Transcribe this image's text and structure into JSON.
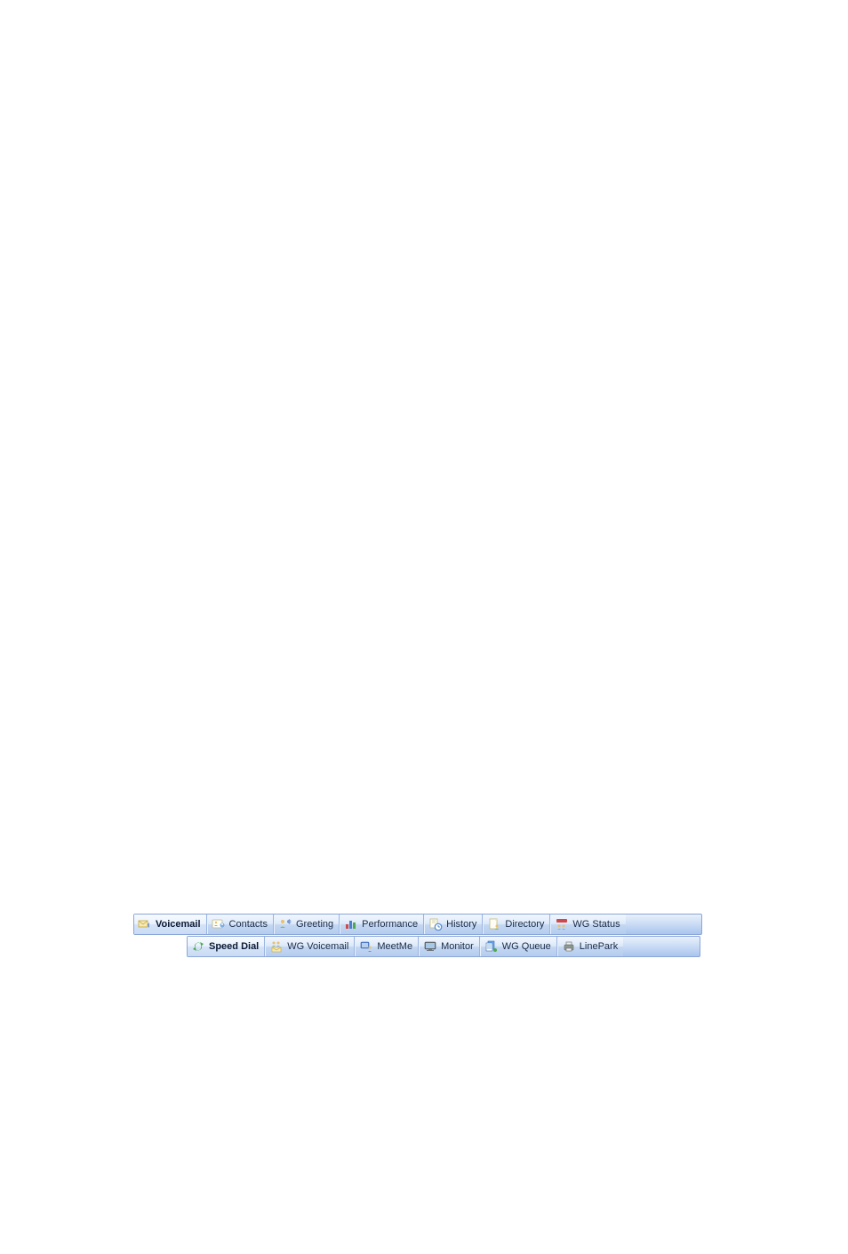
{
  "tabs_row1": [
    {
      "id": "voicemail",
      "label": "Voicemail",
      "active": true,
      "icon": "envelope-speaker"
    },
    {
      "id": "contacts",
      "label": "Contacts",
      "active": false,
      "icon": "card-people"
    },
    {
      "id": "greeting",
      "label": "Greeting",
      "active": false,
      "icon": "people-speaker"
    },
    {
      "id": "performance",
      "label": "Performance",
      "active": false,
      "icon": "bar-chart"
    },
    {
      "id": "history",
      "label": "History",
      "active": false,
      "icon": "document-clock"
    },
    {
      "id": "directory",
      "label": "Directory",
      "active": false,
      "icon": "document-person"
    },
    {
      "id": "wg-status",
      "label": "WG Status",
      "active": false,
      "icon": "people-status"
    }
  ],
  "tabs_row2": [
    {
      "id": "speed-dial",
      "label": "Speed Dial",
      "active": true,
      "icon": "refresh-arrows"
    },
    {
      "id": "wg-voicemail",
      "label": "WG Voicemail",
      "active": false,
      "icon": "people-envelope"
    },
    {
      "id": "meetme",
      "label": "MeetMe",
      "active": false,
      "icon": "monitor-person"
    },
    {
      "id": "monitor",
      "label": "Monitor",
      "active": false,
      "icon": "monitor"
    },
    {
      "id": "wg-queue",
      "label": "WG Queue",
      "active": false,
      "icon": "document-queue"
    },
    {
      "id": "linepark",
      "label": "LinePark",
      "active": false,
      "icon": "printer-fax"
    }
  ]
}
